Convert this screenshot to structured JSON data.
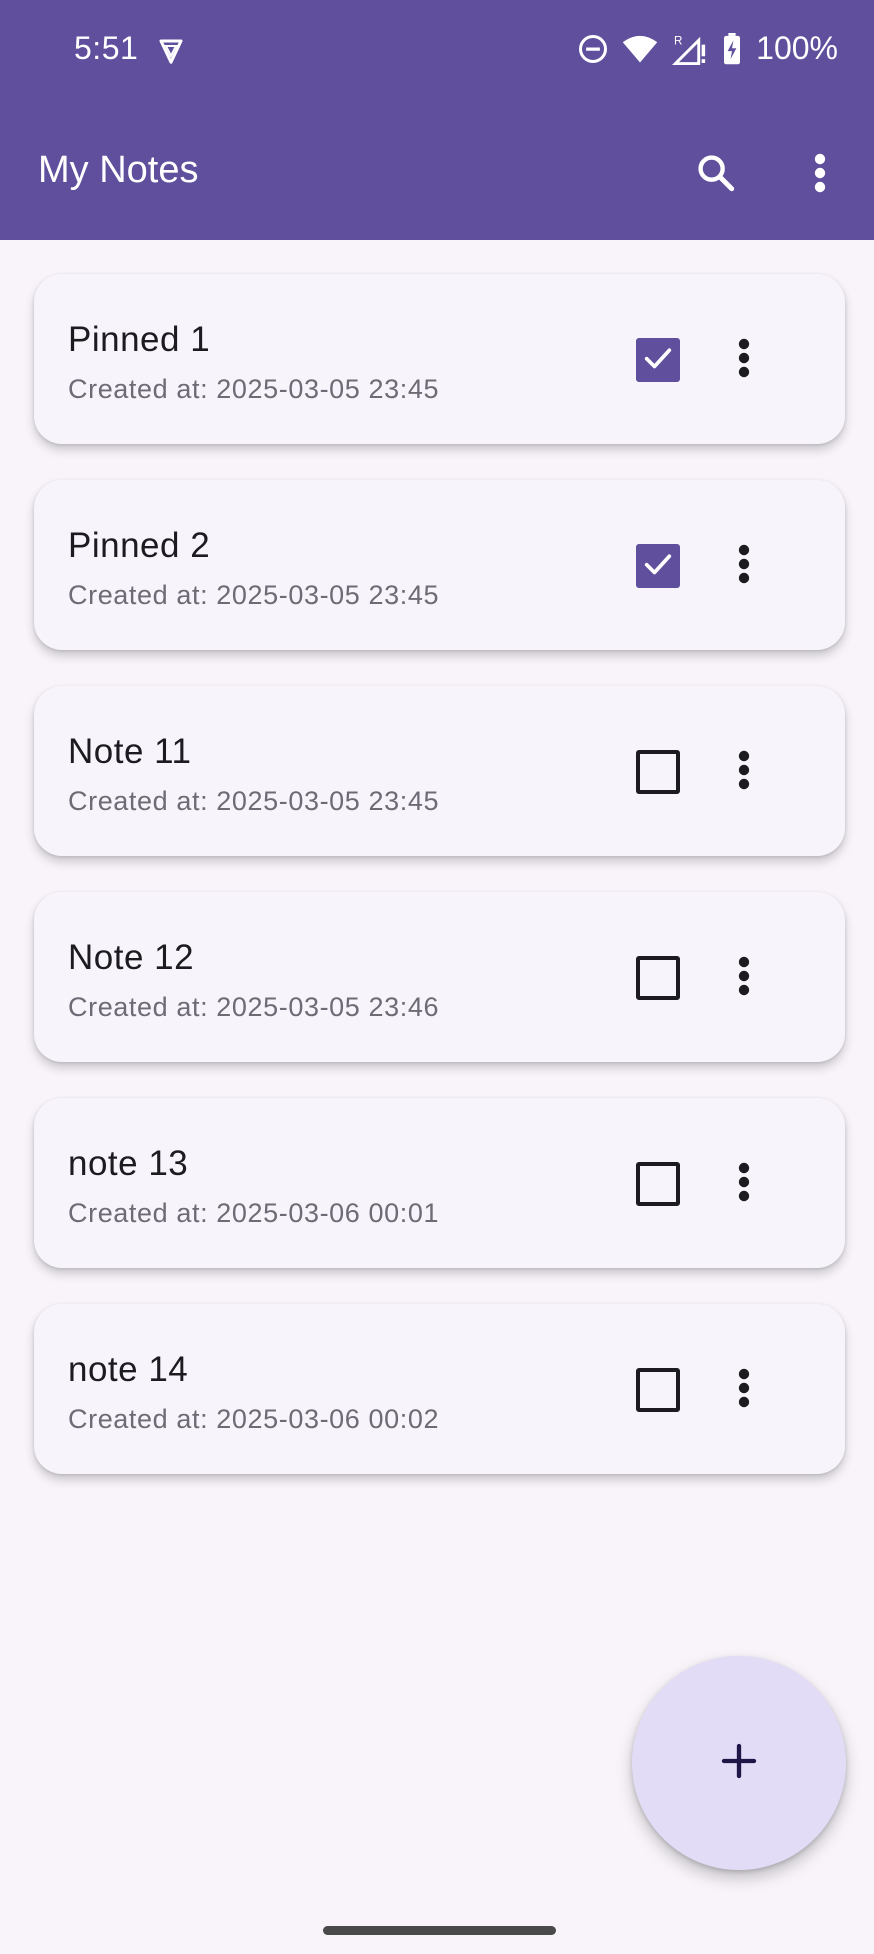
{
  "status_bar": {
    "time": "5:51",
    "battery": "100%",
    "icons": [
      "vpn-shield-icon",
      "do-not-disturb-icon",
      "wifi-icon",
      "signal-roaming-icon",
      "battery-charging-icon"
    ]
  },
  "app_bar": {
    "title": "My Notes",
    "icons": [
      "search-icon",
      "more-vert-icon"
    ]
  },
  "notes": [
    {
      "title": "Pinned 1",
      "created": "Created at: 2025-03-05 23:45",
      "checked": true
    },
    {
      "title": "Pinned 2",
      "created": "Created at: 2025-03-05 23:45",
      "checked": true
    },
    {
      "title": "Note 11",
      "created": "Created at: 2025-03-05 23:45",
      "checked": false
    },
    {
      "title": "Note 12",
      "created": "Created at: 2025-03-05 23:46",
      "checked": false
    },
    {
      "title": "note 13",
      "created": "Created at: 2025-03-06 00:01",
      "checked": false
    },
    {
      "title": "note 14",
      "created": "Created at: 2025-03-06 00:02",
      "checked": false
    }
  ],
  "fab": {
    "icon": "plus-icon",
    "label": "+"
  },
  "colors": {
    "primary": "#5F4F9C",
    "background": "#F8F4FA",
    "fab": "#E3DCF7",
    "text": "#1C1B1F",
    "subtext": "#6F6B76"
  }
}
